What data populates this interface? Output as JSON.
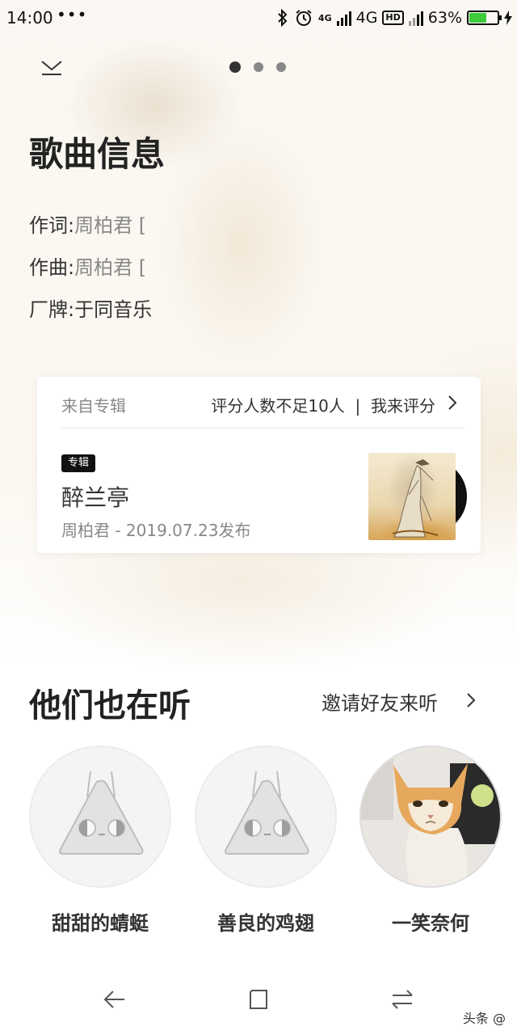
{
  "status_bar": {
    "time": "14:00",
    "dots": "•••",
    "network_top": "4G",
    "network": "4G",
    "hd": "HD",
    "battery_percent": "63%",
    "battery_level": 0.63,
    "icons": [
      "bluetooth-icon",
      "alarm-icon",
      "signal-icon",
      "battery-icon"
    ]
  },
  "pager": {
    "count": 3,
    "active_index": 0
  },
  "song_info": {
    "title": "歌曲信息",
    "lyricist_label": "作词:",
    "lyricist_value": "周柏君 [",
    "composer_label": "作曲:",
    "composer_value": "周柏君 [",
    "label_label": "厂牌:",
    "label_value": "于同音乐"
  },
  "album_card": {
    "from_label": "来自专辑",
    "rating_text": "评分人数不足10人  |  我来评分",
    "badge": "专辑",
    "album_name": "醉兰亭",
    "meta": "周柏君 - 2019.07.23发布"
  },
  "listeners": {
    "title": "他们也在听",
    "invite": "邀请好友来听",
    "users": [
      {
        "name": "甜甜的蜻蜓",
        "avatar": "default-avatar"
      },
      {
        "name": "善良的鸡翅",
        "avatar": "default-avatar"
      },
      {
        "name": "一笑奈何",
        "avatar": "cat-photo"
      }
    ]
  },
  "nav": {
    "icons": [
      "back-icon",
      "home-icon",
      "recent-apps-icon"
    ]
  },
  "watermark": "头条 @",
  "colors": {
    "accent": "#333333",
    "battery": "#3ccb3c",
    "secondary_text": "#888888"
  }
}
